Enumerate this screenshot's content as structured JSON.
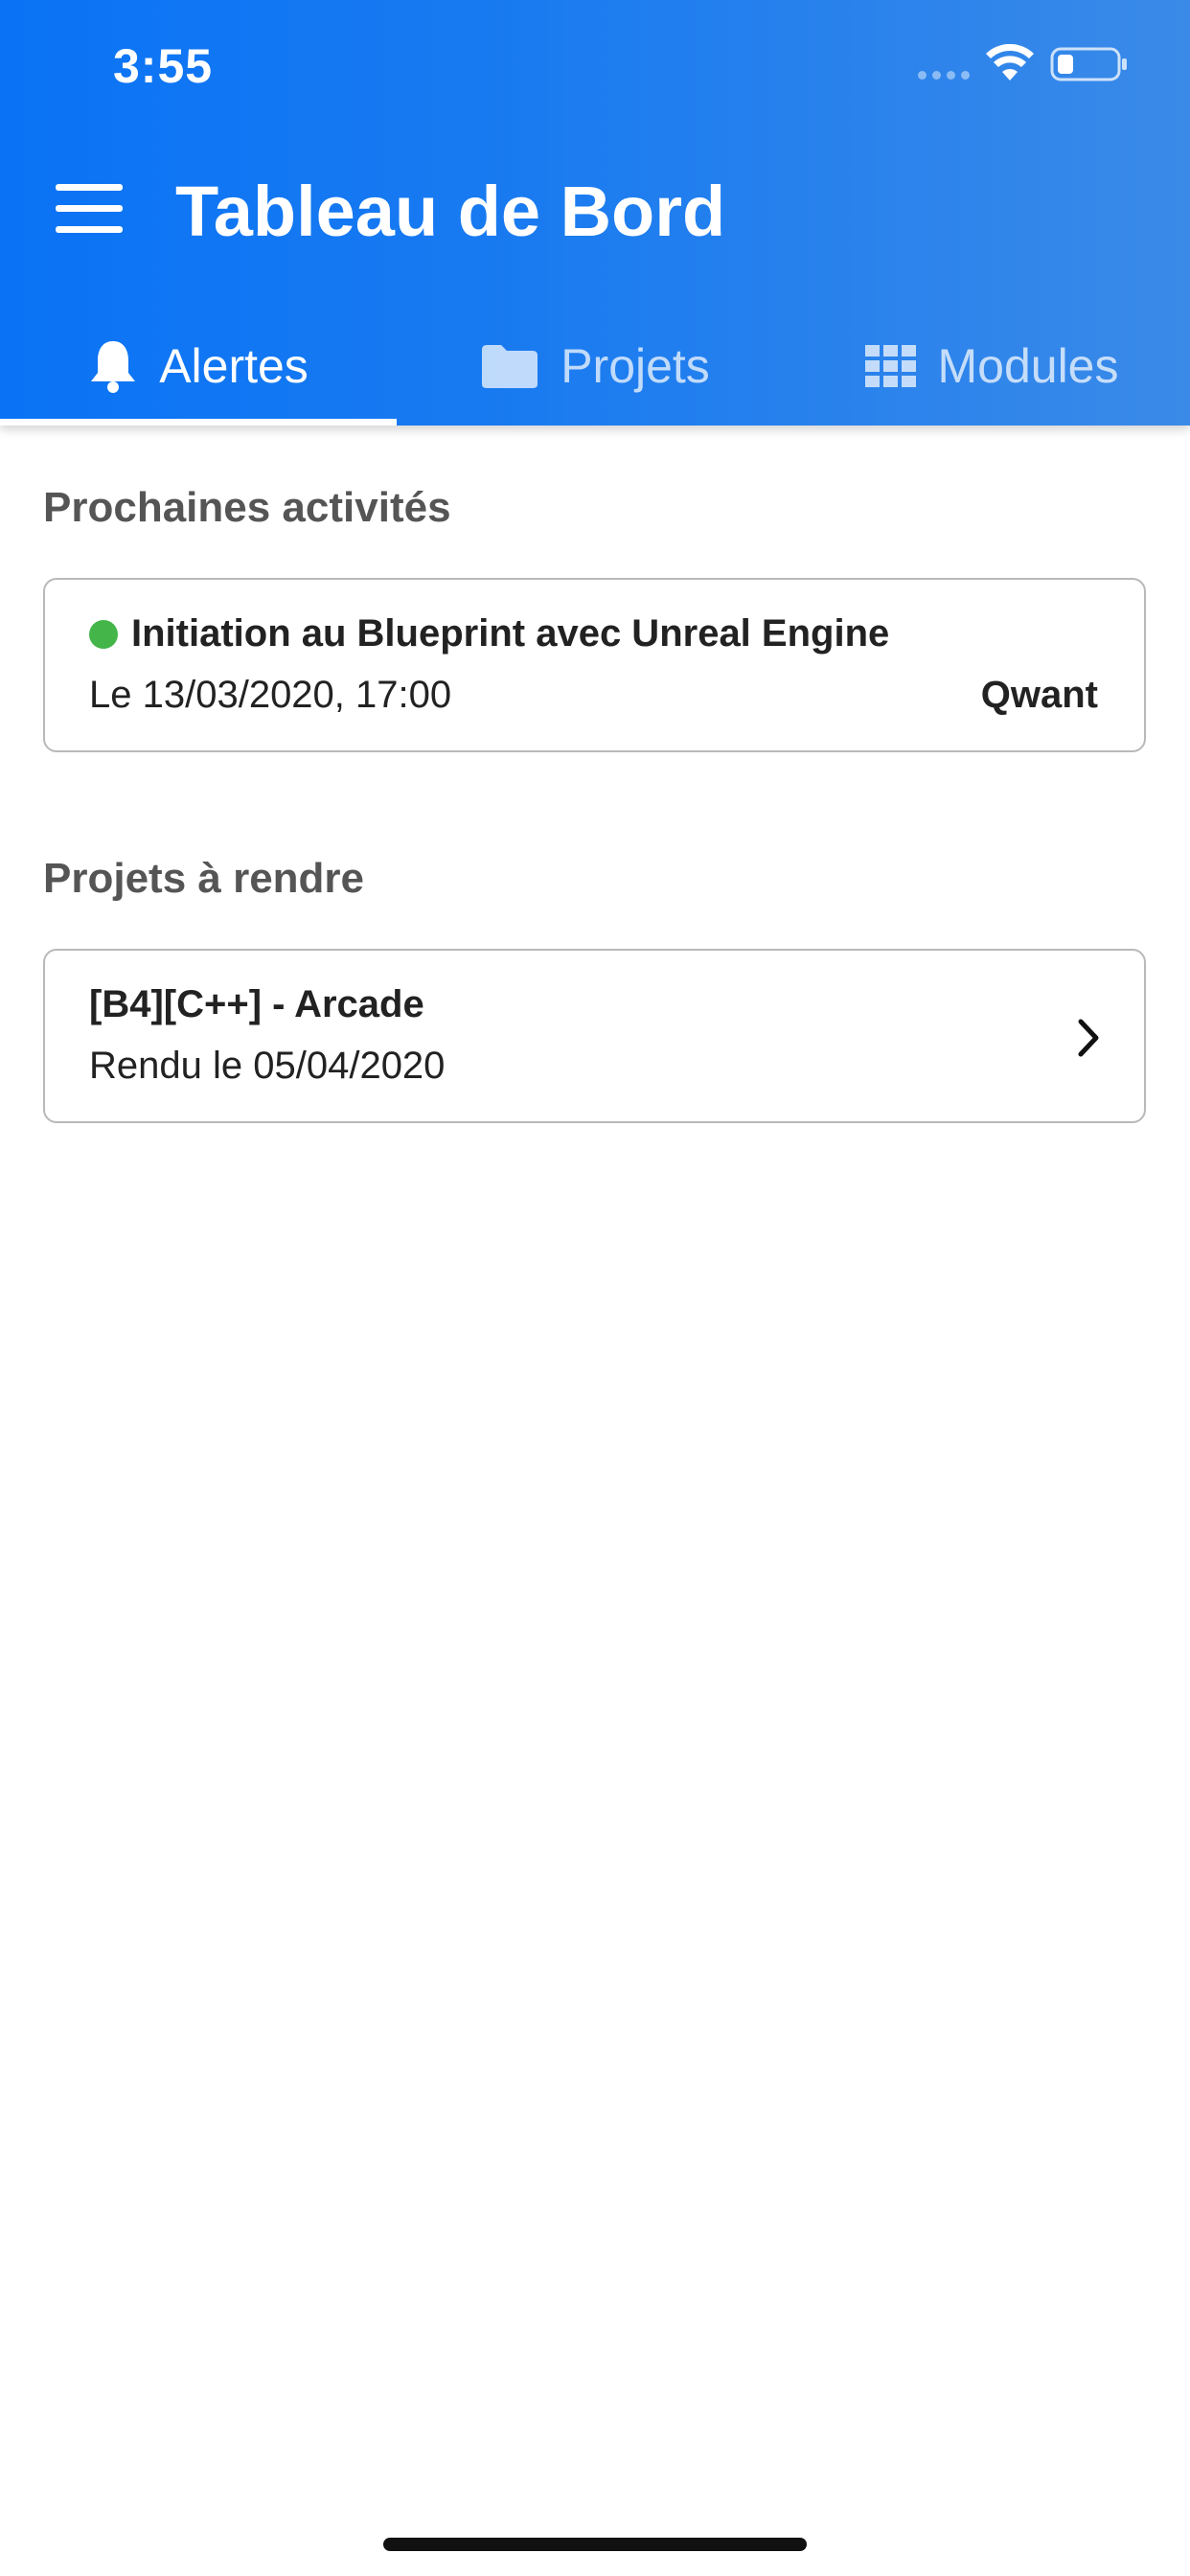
{
  "status_bar": {
    "time": "3:55"
  },
  "header": {
    "title": "Tableau de Bord"
  },
  "tabs": [
    {
      "label": "Alertes",
      "icon": "bell-icon",
      "active": true
    },
    {
      "label": "Projets",
      "icon": "folder-icon",
      "active": false
    },
    {
      "label": "Modules",
      "icon": "grid-icon",
      "active": false
    }
  ],
  "activities": {
    "title": "Prochaines activités",
    "items": [
      {
        "title": "Initiation au Blueprint avec Unreal Engine",
        "date": "Le 13/03/2020, 17:00",
        "location": "Qwant",
        "status_color": "#43b549"
      }
    ]
  },
  "projects": {
    "title": "Projets à rendre",
    "items": [
      {
        "title": "[B4][C++] - Arcade",
        "due": "Rendu le 05/04/2020"
      }
    ]
  },
  "colors": {
    "header_start": "#0a73f5",
    "header_end": "#3a8ae8",
    "status_dot": "#43b549"
  }
}
